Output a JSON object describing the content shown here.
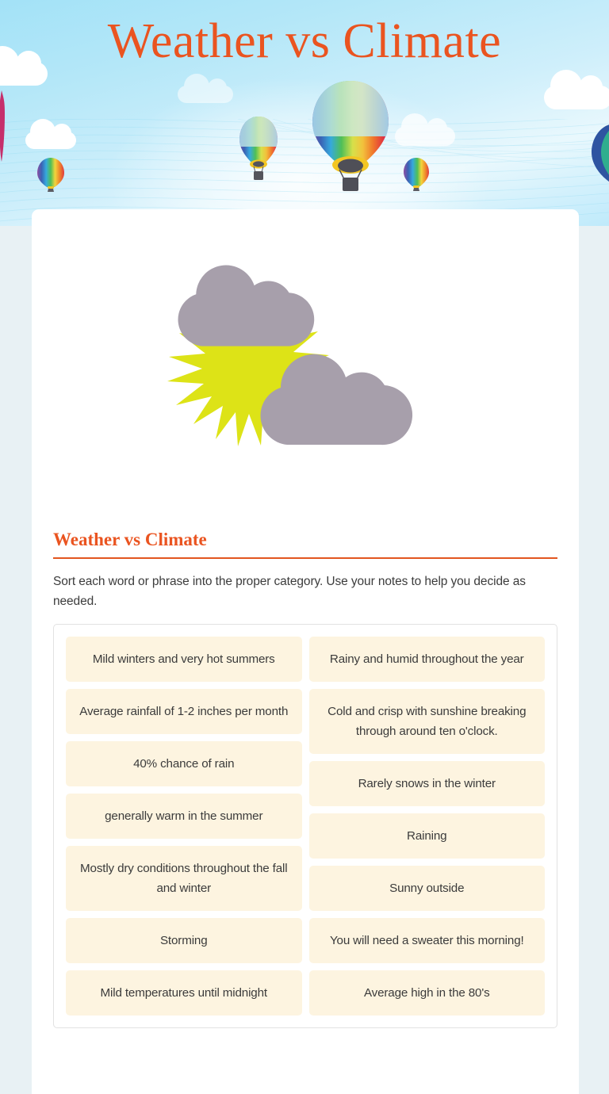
{
  "banner": {
    "title": "Weather vs Climate",
    "icons": {
      "balloon": "hot-air-balloon-icon",
      "cloud": "cloud-icon"
    }
  },
  "illustration": {
    "sun": "sun-icon",
    "rain_cloud": "rain-cloud-icon",
    "sun_behind_cloud": "sun-behind-cloud-icon",
    "raindrop": "raindrop-icon",
    "colors": {
      "sun": "#dde317",
      "cloud": "#a79fab",
      "raindrop": "#1b9ddb"
    }
  },
  "worksheet": {
    "title": "Weather vs Climate",
    "instructions": "Sort each word or phrase into the proper category.  Use your notes to help you decide as needed.",
    "columns": [
      {
        "cards": [
          "Mild winters and very hot summers",
          "Average rainfall of 1-2 inches per month",
          "40% chance of rain",
          "generally warm in the summer",
          "Mostly dry conditions throughout the fall and winter",
          "Storming",
          "Mild temperatures until midnight"
        ]
      },
      {
        "cards": [
          "Rainy and humid throughout the year",
          "Cold and crisp with sunshine breaking through around ten o'clock.",
          "Rarely snows in the winter",
          "Raining",
          "Sunny outside",
          "You will need a sweater this morning!",
          "Average high in the 80's"
        ]
      }
    ]
  },
  "theme": {
    "accent": "#ea5420",
    "card_bg": "#fdf4e0",
    "sky_top": "#a3e2f7",
    "page_bg": "#e8f1f4",
    "sheet_bg": "#ffffff",
    "text": "#3b3b3b"
  }
}
